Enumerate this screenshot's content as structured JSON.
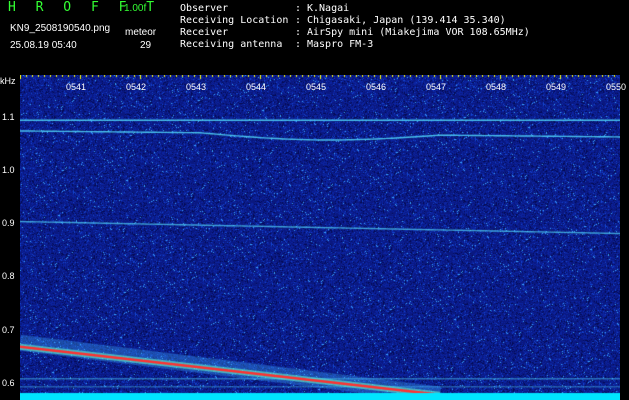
{
  "header": {
    "app_title": "H R O F F T",
    "version": "1.00f",
    "filename": "KN9_2508190540.png",
    "meteor_label": "meteor",
    "timestamp": "25.08.19 05:40",
    "meteor_count": "29"
  },
  "info": {
    "observer_label": "Observer",
    "observer_value": "K.Nagai",
    "location_label": "Receiving Location",
    "location_value": "Chigasaki, Japan (139.414 35.340)",
    "receiver_label": "Receiver",
    "receiver_value": "AirSpy mini (Miakejima VOR 108.65MHz)",
    "antenna_label": "Receiving antenna",
    "antenna_value": "Maspro FM-3",
    "separator": ":"
  },
  "axes": {
    "y_unit": "kHz",
    "y_ticks": [
      "1.1",
      "1.0",
      "0.9",
      "0.8",
      "0.7",
      "0.6"
    ],
    "x_ticks": [
      "0541",
      "0542",
      "0543",
      "0544",
      "0545",
      "0546",
      "0547",
      "0548",
      "0549",
      "0550"
    ]
  },
  "colors": {
    "title_green": "#33ff33",
    "background": "#000000",
    "plot_noise": "#0a1a8c",
    "trace_cyan": "#55e0ff",
    "meteor_red": "#ff3030",
    "bottom_band": "#00e5ff"
  },
  "chart_data": {
    "type": "heatmap",
    "title": "",
    "xlabel": "",
    "ylabel": "kHz",
    "x_range": [
      "0540",
      "0550"
    ],
    "ylim": [
      0.57,
      1.18
    ],
    "horizontal_traces_khz": [
      1.095,
      1.075,
      0.905,
      0.61,
      0.595
    ],
    "meteor_trail": {
      "start": [
        "0540",
        0.67
      ],
      "end": [
        "0547",
        0.58
      ]
    }
  }
}
